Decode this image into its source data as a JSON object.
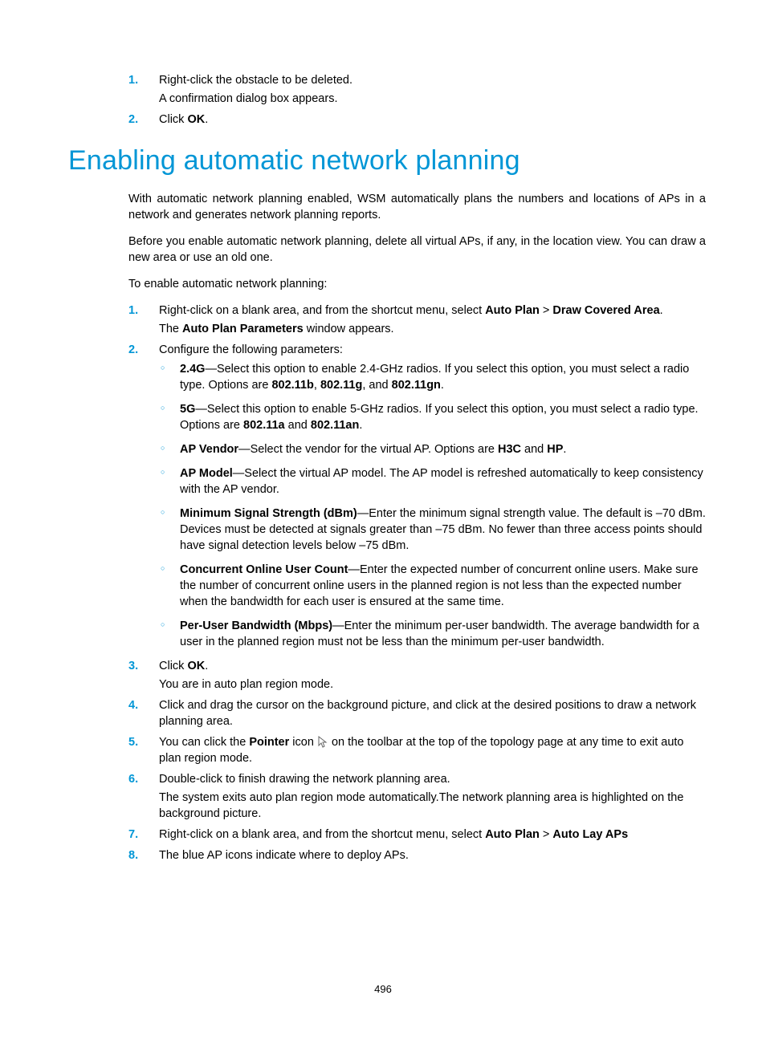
{
  "topList": {
    "item1": {
      "num": "1.",
      "line1": "Right-click the obstacle to be deleted.",
      "line2": "A confirmation dialog box appears."
    },
    "item2": {
      "num": "2.",
      "prefix": "Click ",
      "bold": "OK",
      "suffix": "."
    }
  },
  "heading": "Enabling automatic network planning",
  "intro": {
    "p1": "With automatic network planning enabled, WSM automatically plans the numbers and locations of APs in a network and generates network planning reports.",
    "p2": "Before you enable automatic network planning, delete all virtual APs, if any, in the location view. You can draw a new area or use an old one.",
    "p3": "To enable automatic network planning:"
  },
  "steps": {
    "s1": {
      "num": "1.",
      "pre": "Right-click on a blank area, and from the shortcut menu, select ",
      "b1": "Auto Plan",
      "gt1": " > ",
      "b2": "Draw Covered Area",
      "post": ".",
      "l2a": "The ",
      "l2b": "Auto Plan Parameters",
      "l2c": " window appears."
    },
    "s2": {
      "num": "2.",
      "text": "Configure the following parameters:",
      "b24g": {
        "label": "2.4G",
        "t1": "—Select this option to enable 2.4-GHz radios. If you select this option, you must select a radio type. Options are ",
        "o1": "802.11b",
        "c1": ", ",
        "o2": "802.11g",
        "c2": ", and ",
        "o3": "802.11gn",
        "dot": "."
      },
      "b5g": {
        "label": "5G",
        "t1": "—Select this option to enable 5-GHz radios. If you select this option, you must select a radio type. Options are ",
        "o1": "802.11a",
        "c1": " and ",
        "o2": "802.11an",
        "dot": "."
      },
      "vendor": {
        "label": "AP Vendor",
        "t1": "—Select the vendor for the virtual AP. Options are ",
        "o1": "H3C",
        "c1": " and ",
        "o2": "HP",
        "dot": "."
      },
      "model": {
        "label": "AP Model",
        "t1": "—Select the virtual AP model. The AP model is refreshed automatically to keep consistency with the AP vendor."
      },
      "minsig": {
        "label": "Minimum Signal Strength (dBm)",
        "t1": "—Enter the minimum signal strength value. The default is –70 dBm. Devices must be detected at signals greater than –75 dBm. No fewer than three access points should have signal detection levels below –75 dBm."
      },
      "concurrent": {
        "label": "Concurrent Online User Count",
        "t1": "—Enter the expected number of concurrent online users. Make sure the number of concurrent online users in the planned region is not less than the expected number when the bandwidth for each user is ensured at the same time."
      },
      "peruser": {
        "label": "Per-User Bandwidth (Mbps)",
        "t1": "—Enter the minimum per-user bandwidth. The average bandwidth for a user in the planned region must not be less than the minimum per-user bandwidth."
      }
    },
    "s3": {
      "num": "3.",
      "pre": "Click ",
      "b1": "OK",
      "post": ".",
      "l2": "You are in auto plan region mode."
    },
    "s4": {
      "num": "4.",
      "text": "Click and drag the cursor on the background picture, and click at the desired positions to draw a network planning area."
    },
    "s5": {
      "num": "5.",
      "pre": "You can click the ",
      "b1": "Pointer",
      "mid": " icon ",
      "post": " on the toolbar at the top of the topology page at any time to exit auto plan region mode."
    },
    "s6": {
      "num": "6.",
      "l1": "Double-click to finish drawing the network planning area.",
      "l2": "The system exits auto plan region mode automatically.The network planning area is highlighted on the background picture."
    },
    "s7": {
      "num": "7.",
      "pre": "Right-click on a blank area, and from the shortcut menu, select ",
      "b1": "Auto Plan",
      "gt1": " > ",
      "b2": "Auto Lay APs"
    },
    "s8": {
      "num": "8.",
      "text": "The blue AP icons indicate where to deploy APs."
    }
  },
  "pageNum": "496"
}
